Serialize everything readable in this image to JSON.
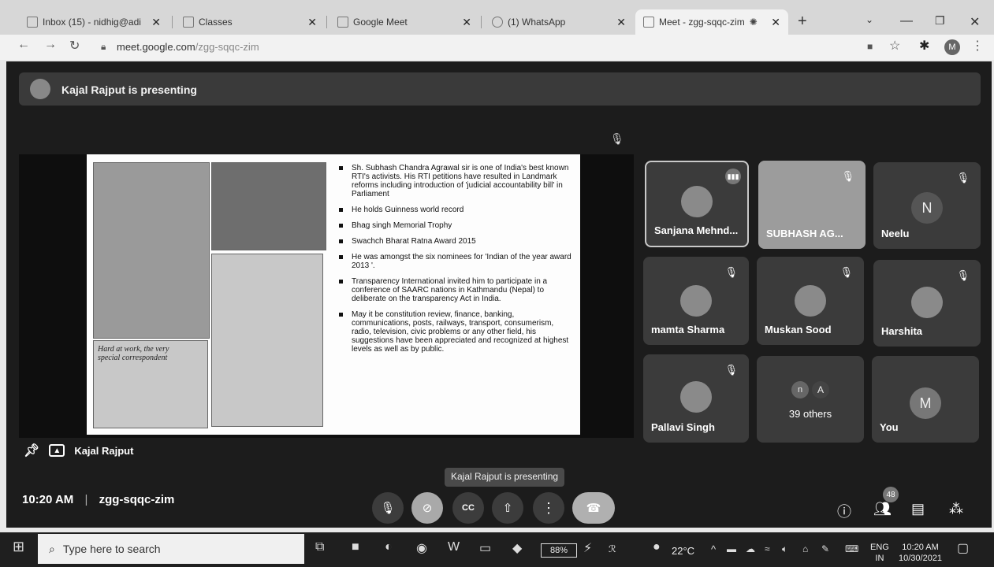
{
  "browser": {
    "tabs": [
      {
        "title": "Inbox (15) - nidhig@adi",
        "left": 0
      },
      {
        "title": "Classes"
      },
      {
        "title": "Google Meet"
      },
      {
        "title": "(1) WhatsApp"
      },
      {
        "title": "Meet - zgg-sqqc-zim"
      }
    ],
    "url_host": "meet.google.com",
    "url_path": "/zgg-sqqc-zim",
    "profile_initial": "M"
  },
  "meet": {
    "presenting_banner": "Kajal Rajput is presenting",
    "presenter_name": "Kajal Rajput",
    "tooltip": "Kajal Rajput is presenting",
    "time": "10:20 AM",
    "meeting_code": "zgg-sqqc-zim",
    "people_count": "48",
    "slide": {
      "caption": "Hard at work, the very special correspondent",
      "bullets": [
        "Sh. Subhash Chandra Agrawal sir is one of India's best known RTI's activists. His RTI petitions have resulted in Landmark reforms including introduction of 'judicial accountability bill' in Parliament",
        "He holds Guinness world record",
        "Bhag singh Memorial Trophy",
        "Swachch Bharat Ratna Award 2015",
        "He was amongst the six nominees for 'Indian of the year award 2013 '.",
        "Transparency International invited him to participate in a conference of SAARC nations in Kathmandu (Nepal) to deliberate on the transparency Act in India.",
        "May it be constitution review, finance, banking, communications, posts, railways, transport, consumerism, radio, television, civic problems or any other field, his suggestions have been appreciated and recognized at highest levels as well as by public."
      ]
    },
    "participants": [
      {
        "name": "Sanjana Mehnd...",
        "kind": "avatar"
      },
      {
        "name": "SUBHASH AG...",
        "kind": "photo"
      },
      {
        "name": "Neelu",
        "kind": "initial",
        "initial": "N"
      },
      {
        "name": "mamta Sharma",
        "kind": "avatar"
      },
      {
        "name": "Muskan Sood",
        "kind": "avatar"
      },
      {
        "name": "Harshita",
        "kind": "avatar"
      },
      {
        "name": "Pallavi Singh",
        "kind": "avatar"
      },
      {
        "name": "39 others",
        "kind": "others",
        "initials": [
          "n",
          "A"
        ]
      },
      {
        "name": "You",
        "kind": "initial",
        "initial": "M"
      }
    ]
  },
  "taskbar": {
    "search_placeholder": "Type here to search",
    "battery": "88%",
    "temperature": "22°C",
    "lang_top": "ENG",
    "lang_bottom": "IN",
    "clock_time": "10:20 AM",
    "clock_date": "10/30/2021"
  }
}
